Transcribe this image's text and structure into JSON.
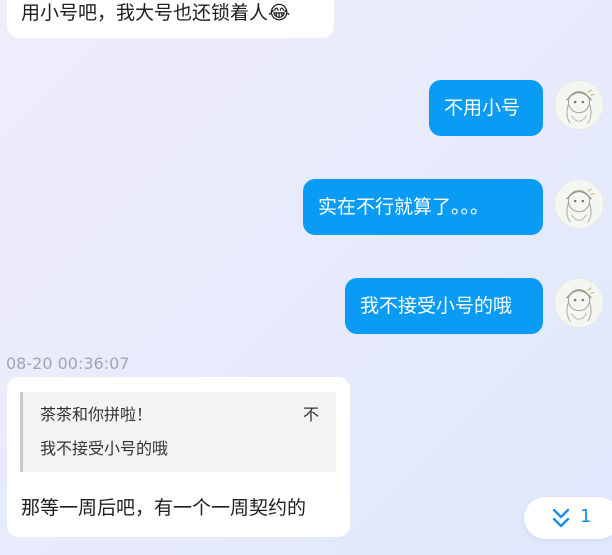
{
  "messages": [
    {
      "id": "m0",
      "side": "in",
      "text": "用小号吧，我大号也还锁着人😂"
    },
    {
      "id": "m1",
      "side": "out",
      "text": "不用小号"
    },
    {
      "id": "m2",
      "side": "out",
      "text": "实在不行就算了。。。"
    },
    {
      "id": "m3",
      "side": "out",
      "text": "我不接受小号的哦"
    }
  ],
  "timestamp": "08-20 00:36:07",
  "reply_message": {
    "quote_author": "茶茶和你拼啦！",
    "quote_mark": "不",
    "quote_text": "我不接受小号的哦",
    "text": "那等一周后吧，有一个一周契约的"
  },
  "scroll_to_new": {
    "icon": "double-chevron-down-icon",
    "count": "1"
  },
  "colors": {
    "outgoing_bubble": "#0a9bf5",
    "incoming_bubble": "#ffffff",
    "timestamp": "#a3a3b3",
    "accent": "#1a8cf0"
  }
}
